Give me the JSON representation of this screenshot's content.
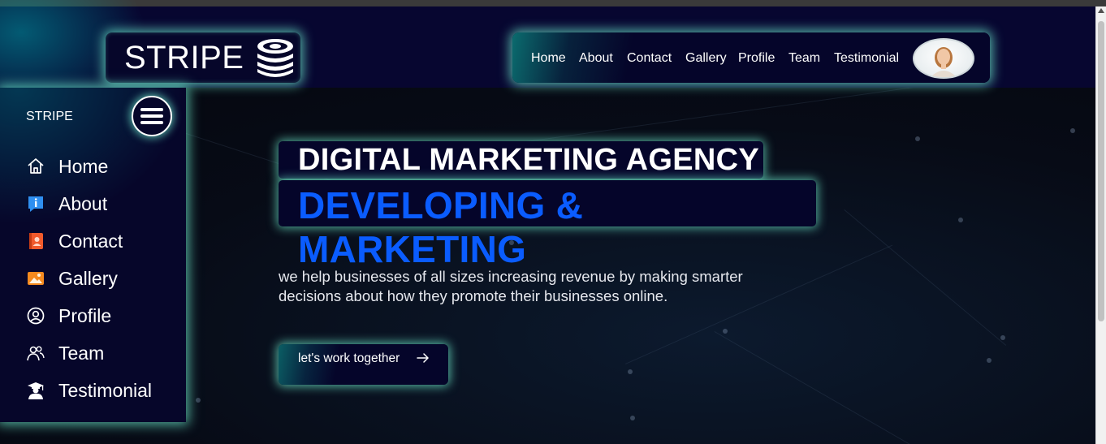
{
  "brand": {
    "logo_text": "STRIPE",
    "sidebar_text": "STRIPE"
  },
  "topnav": {
    "items": [
      "Home",
      "About",
      "Contact",
      "Gallery",
      "Profile",
      "Team",
      "Testimonial"
    ]
  },
  "sidebar": {
    "items": [
      {
        "label": "Home",
        "icon": "home-icon"
      },
      {
        "label": "About",
        "icon": "info-icon"
      },
      {
        "label": "Contact",
        "icon": "contact-book-icon"
      },
      {
        "label": "Gallery",
        "icon": "gallery-icon"
      },
      {
        "label": "Profile",
        "icon": "user-circle-icon"
      },
      {
        "label": "Team",
        "icon": "team-icon"
      },
      {
        "label": "Testimonial",
        "icon": "graduate-icon"
      }
    ]
  },
  "hero": {
    "title": "DIGITAL MARKETING AGENCY",
    "subtitle": "DEVELOPING & MARKETING",
    "description": "we help businesses of all sizes increasing revenue by making smarter decisions about how they promote their businesses online.",
    "cta_label": "let's work together"
  },
  "colors": {
    "glow": "#6eebcd",
    "panel": "#06062a",
    "accent_blue": "#0a5cff",
    "header_bg": "#070630"
  }
}
